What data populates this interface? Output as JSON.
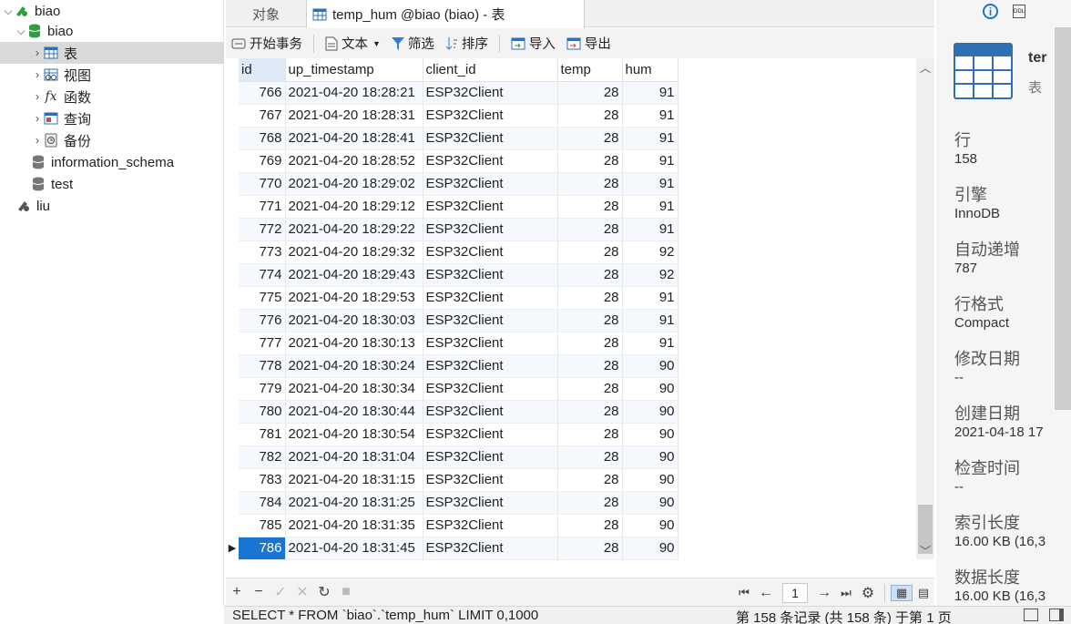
{
  "colors": {
    "accent": "#1a74d1",
    "row_alt": "#f5f8fd",
    "nav_selected": "#d9d9d9",
    "db_green": "#2e9e3e"
  },
  "nav": {
    "connection": "biao",
    "database": "biao",
    "items": [
      {
        "label": "表",
        "icon": "table-icon"
      },
      {
        "label": "视图",
        "icon": "view-icon"
      },
      {
        "label": "函数",
        "icon": "function-icon"
      },
      {
        "label": "查询",
        "icon": "query-icon"
      },
      {
        "label": "备份",
        "icon": "backup-icon"
      }
    ],
    "other_databases": [
      "information_schema",
      "test"
    ],
    "other_connection": "liu"
  },
  "tabs": {
    "objects": "对象",
    "active": "temp_hum @biao (biao) - 表"
  },
  "toolbar": {
    "begin_tx": "开始事务",
    "text": "文本",
    "filter": "筛选",
    "sort": "排序",
    "import": "导入",
    "export": "导出"
  },
  "grid": {
    "columns": [
      "id",
      "up_timestamp",
      "client_id",
      "temp",
      "hum"
    ],
    "rows": [
      [
        "766",
        "2021-04-20 18:28:21",
        "ESP32Client",
        "28",
        "91"
      ],
      [
        "767",
        "2021-04-20 18:28:31",
        "ESP32Client",
        "28",
        "91"
      ],
      [
        "768",
        "2021-04-20 18:28:41",
        "ESP32Client",
        "28",
        "91"
      ],
      [
        "769",
        "2021-04-20 18:28:52",
        "ESP32Client",
        "28",
        "91"
      ],
      [
        "770",
        "2021-04-20 18:29:02",
        "ESP32Client",
        "28",
        "91"
      ],
      [
        "771",
        "2021-04-20 18:29:12",
        "ESP32Client",
        "28",
        "91"
      ],
      [
        "772",
        "2021-04-20 18:29:22",
        "ESP32Client",
        "28",
        "91"
      ],
      [
        "773",
        "2021-04-20 18:29:32",
        "ESP32Client",
        "28",
        "92"
      ],
      [
        "774",
        "2021-04-20 18:29:43",
        "ESP32Client",
        "28",
        "92"
      ],
      [
        "775",
        "2021-04-20 18:29:53",
        "ESP32Client",
        "28",
        "91"
      ],
      [
        "776",
        "2021-04-20 18:30:03",
        "ESP32Client",
        "28",
        "91"
      ],
      [
        "777",
        "2021-04-20 18:30:13",
        "ESP32Client",
        "28",
        "91"
      ],
      [
        "778",
        "2021-04-20 18:30:24",
        "ESP32Client",
        "28",
        "90"
      ],
      [
        "779",
        "2021-04-20 18:30:34",
        "ESP32Client",
        "28",
        "90"
      ],
      [
        "780",
        "2021-04-20 18:30:44",
        "ESP32Client",
        "28",
        "90"
      ],
      [
        "781",
        "2021-04-20 18:30:54",
        "ESP32Client",
        "28",
        "90"
      ],
      [
        "782",
        "2021-04-20 18:31:04",
        "ESP32Client",
        "28",
        "90"
      ],
      [
        "783",
        "2021-04-20 18:31:15",
        "ESP32Client",
        "28",
        "90"
      ],
      [
        "784",
        "2021-04-20 18:31:25",
        "ESP32Client",
        "28",
        "90"
      ],
      [
        "785",
        "2021-04-20 18:31:35",
        "ESP32Client",
        "28",
        "90"
      ],
      [
        "786",
        "2021-04-20 18:31:45",
        "ESP32Client",
        "28",
        "90"
      ]
    ]
  },
  "pager": {
    "page": "1"
  },
  "status": {
    "sql": "SELECT * FROM `biao`.`temp_hum` LIMIT 0,1000",
    "records": "第 158 条记录 (共 158 条) 于第 1 页"
  },
  "info": {
    "title": "ter",
    "type": "表",
    "fields": [
      {
        "label": "行",
        "value": "158"
      },
      {
        "label": "引擎",
        "value": "InnoDB"
      },
      {
        "label": "自动递增",
        "value": "787"
      },
      {
        "label": "行格式",
        "value": "Compact"
      },
      {
        "label": "修改日期",
        "value": "--"
      },
      {
        "label": "创建日期",
        "value": "2021-04-18 17"
      },
      {
        "label": "检查时间",
        "value": "--"
      },
      {
        "label": "索引长度",
        "value": "16.00 KB (16,3"
      },
      {
        "label": "数据长度",
        "value": "16.00 KB (16,3"
      }
    ]
  }
}
